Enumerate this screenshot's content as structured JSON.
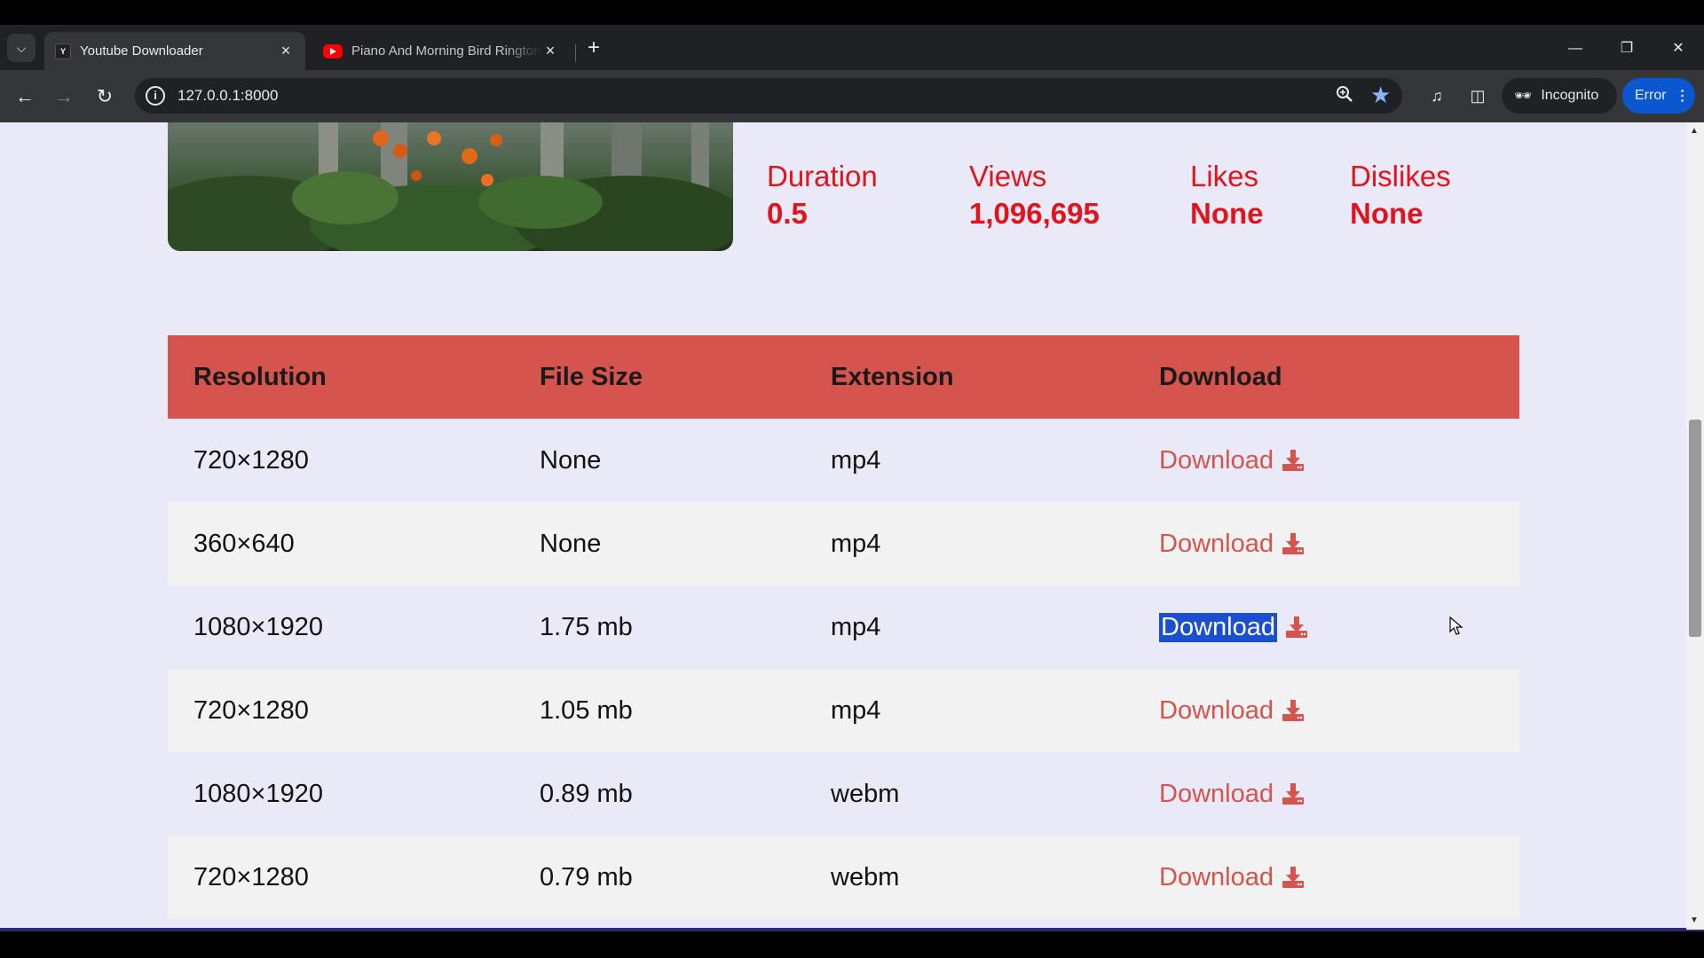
{
  "browser": {
    "tabs": [
      {
        "title": "Youtube Downloader",
        "active": true
      },
      {
        "title": "Piano And Morning Bird Ringtone",
        "active": false
      }
    ],
    "url": "127.0.0.1:8000",
    "incognito_label": "Incognito",
    "error_label": "Error"
  },
  "video": {
    "stats": [
      {
        "label": "Duration",
        "value": "0.5"
      },
      {
        "label": "Views",
        "value": "1,096,695"
      },
      {
        "label": "Likes",
        "value": "None"
      },
      {
        "label": "Dislikes",
        "value": "None"
      }
    ]
  },
  "table": {
    "headers": [
      "Resolution",
      "File Size",
      "Extension",
      "Download"
    ],
    "rows": [
      {
        "resolution": "720×1280",
        "size": "None",
        "ext": "mp4",
        "link": "Download"
      },
      {
        "resolution": "360×640",
        "size": "None",
        "ext": "mp4",
        "link": "Download"
      },
      {
        "resolution": "1080×1920",
        "size": "1.75 mb",
        "ext": "mp4",
        "link": "Download"
      },
      {
        "resolution": "720×1280",
        "size": "1.05 mb",
        "ext": "mp4",
        "link": "Download"
      },
      {
        "resolution": "1080×1920",
        "size": "0.89 mb",
        "ext": "webm",
        "link": "Download"
      },
      {
        "resolution": "720×1280",
        "size": "0.79 mb",
        "ext": "webm",
        "link": "Download"
      }
    ]
  },
  "colors": {
    "accent_red": "#e1141c",
    "table_header": "#d6544e",
    "selection": "#1a4fcf"
  }
}
